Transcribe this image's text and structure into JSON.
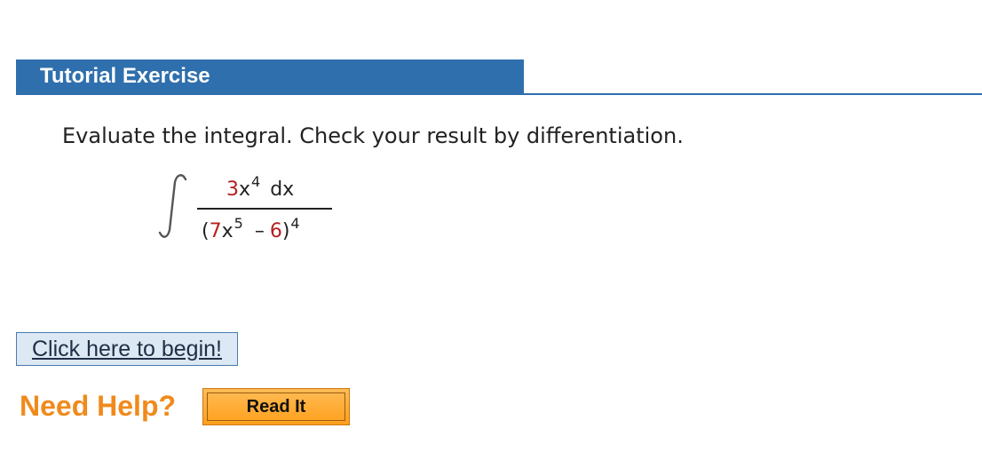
{
  "header": {
    "title": "Tutorial Exercise"
  },
  "question": {
    "instruction": "Evaluate the integral. Check your result by differentiation.",
    "integrand": {
      "numerator": {
        "coefficient": "3",
        "variable": "x",
        "exponent": "4",
        "differential": "dx"
      },
      "denominator": {
        "open_paren": "(",
        "coefficient": "7",
        "variable": "x",
        "exponent": "5",
        "operator": "–",
        "constant": "6",
        "close_paren": ")",
        "power": "4"
      }
    }
  },
  "actions": {
    "begin_label": "Click here to begin!",
    "need_help_label": "Need Help?",
    "read_it_label": "Read It"
  },
  "colors": {
    "header_blue": "#2f6fad",
    "highlight_red": "#b51f1f",
    "help_orange": "#f08a1c",
    "button_orange": "#ff9f1c"
  }
}
